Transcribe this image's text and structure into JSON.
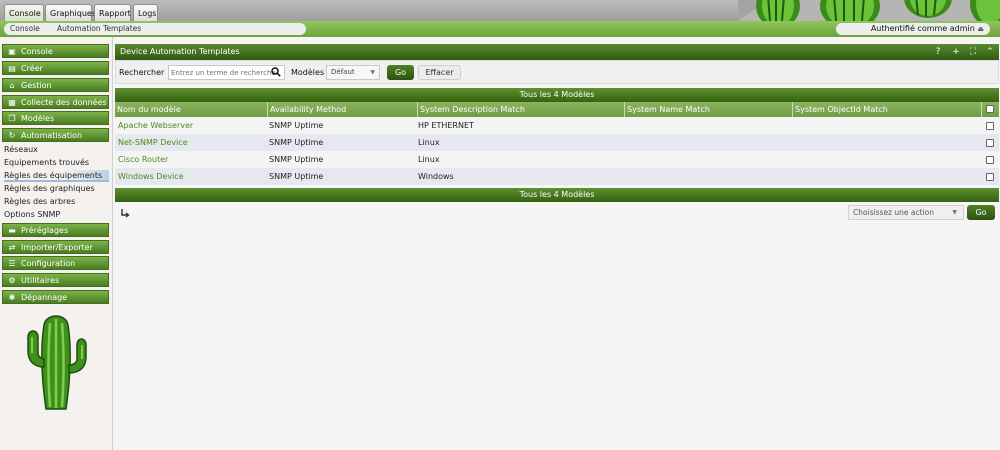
{
  "top_tabs": [
    "Console",
    "Graphiques",
    "Rapport",
    "Logs"
  ],
  "breadcrumb": [
    "Console",
    "Automation Templates"
  ],
  "auth_text": "Authentifié comme admin",
  "sidebar": {
    "sections": [
      {
        "label": "Console",
        "icon": "book-icon"
      },
      {
        "label": "Créer",
        "icon": "create-icon"
      },
      {
        "label": "Gestion",
        "icon": "home-icon"
      },
      {
        "label": "Collecte des données",
        "icon": "database-icon"
      },
      {
        "label": "Modèles",
        "icon": "copy-icon"
      },
      {
        "label": "Automatisation",
        "icon": "refresh-icon"
      }
    ],
    "sub_items": [
      "Réseaux",
      "Equipements trouvés",
      "Règles des équipements",
      "Règles des graphiques",
      "Règles des arbres",
      "Options SNMP"
    ],
    "active_sub": "Règles des équipements",
    "sections_after": [
      {
        "label": "Préréglages",
        "icon": "preset-icon"
      },
      {
        "label": "Importer/Exporter",
        "icon": "exchange-icon"
      },
      {
        "label": "Configuration",
        "icon": "sliders-icon"
      },
      {
        "label": "Utilitaires",
        "icon": "cogs-icon"
      },
      {
        "label": "Dépannage",
        "icon": "bug-icon"
      }
    ]
  },
  "panel": {
    "title": "Device Automation Templates",
    "header_icons": [
      "help-icon",
      "add-icon",
      "fullscreen-icon",
      "collapse-icon"
    ]
  },
  "filter": {
    "search_label": "Rechercher",
    "search_placeholder": "Entrez un terme de recherche",
    "models_label": "Modèles",
    "models_value": "Défaut",
    "go_label": "Go",
    "clear_label": "Effacer"
  },
  "table": {
    "summary": "Tous les 4 Modèles",
    "columns": [
      "Nom du modèle",
      "Availability Method",
      "System Description Match",
      "System Name Match",
      "System ObjectId Match"
    ],
    "rows": [
      {
        "name": "Apache Webserver",
        "availability": "SNMP Uptime",
        "sys_desc": "HP ETHERNET",
        "sys_name": "",
        "sys_oid": ""
      },
      {
        "name": "Net-SNMP Device",
        "availability": "SNMP Uptime",
        "sys_desc": "Linux",
        "sys_name": "",
        "sys_oid": ""
      },
      {
        "name": "Cisco Router",
        "availability": "SNMP Uptime",
        "sys_desc": "Linux",
        "sys_name": "",
        "sys_oid": ""
      },
      {
        "name": "Windows Device",
        "availability": "SNMP Uptime",
        "sys_desc": "Windows",
        "sys_name": "",
        "sys_oid": ""
      }
    ]
  },
  "actions": {
    "select_placeholder": "Choisissez une action",
    "go_label": "Go"
  },
  "colors": {
    "accent_green": "#4a7d22",
    "link_green": "#4a8a1e",
    "header_dark": "#2f5a12"
  }
}
